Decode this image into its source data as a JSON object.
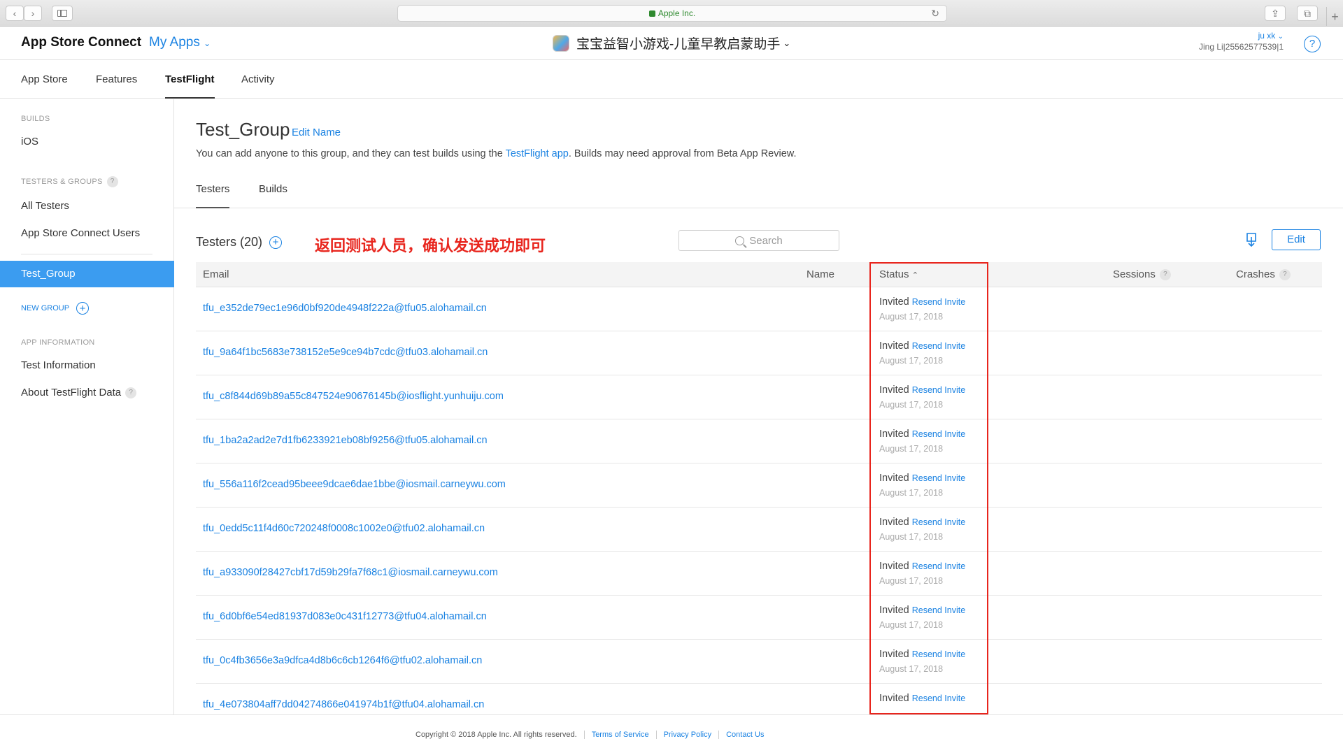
{
  "browser": {
    "url_text": "Apple Inc.",
    "back_glyph": "‹",
    "forward_glyph": "›",
    "reload_glyph": "↻",
    "share_glyph": "⇪",
    "tabs_glyph": "⧉",
    "new_tab_glyph": "+"
  },
  "header": {
    "brand": "App Store Connect",
    "my_apps": "My Apps",
    "app_name": "宝宝益智小游戏-儿童早教启蒙助手",
    "user_name": "ju xk",
    "user_org": "Jing Li|25562577539|1",
    "help_glyph": "?"
  },
  "main_tabs": [
    "App Store",
    "Features",
    "TestFlight",
    "Activity"
  ],
  "sidebar": {
    "builds_heading": "BUILDS",
    "ios": "iOS",
    "testers_heading": "TESTERS & GROUPS",
    "all_testers": "All Testers",
    "asc_users": "App Store Connect Users",
    "active_group": "Test_Group",
    "new_group": "NEW GROUP",
    "app_info_heading": "APP INFORMATION",
    "test_information": "Test Information",
    "about_data": "About TestFlight Data"
  },
  "content": {
    "group_title": "Test_Group",
    "edit_name": "Edit Name",
    "desc_before": "You can add anyone to this group, and they can test builds using the ",
    "desc_link": "TestFlight app",
    "desc_after": ". Builds may need approval from Beta App Review.",
    "subtabs": [
      "Testers",
      "Builds"
    ],
    "testers_title": "Testers (20)",
    "annotation": "返回测试人员，确认发送成功即可",
    "search_placeholder": "Search",
    "edit_button": "Edit"
  },
  "table": {
    "headers": {
      "email": "Email",
      "name": "Name",
      "status": "Status",
      "sessions": "Sessions",
      "crashes": "Crashes"
    },
    "rows": [
      {
        "email": "tfu_e352de79ec1e96d0bf920de4948f222a@tfu05.alohamail.cn",
        "status": "Invited",
        "action": "Resend Invite",
        "date": "August 17, 2018"
      },
      {
        "email": "tfu_9a64f1bc5683e738152e5e9ce94b7cdc@tfu03.alohamail.cn",
        "status": "Invited",
        "action": "Resend Invite",
        "date": "August 17, 2018"
      },
      {
        "email": "tfu_c8f844d69b89a55c847524e90676145b@iosflight.yunhuiju.com",
        "status": "Invited",
        "action": "Resend Invite",
        "date": "August 17, 2018"
      },
      {
        "email": "tfu_1ba2a2ad2e7d1fb6233921eb08bf9256@tfu05.alohamail.cn",
        "status": "Invited",
        "action": "Resend Invite",
        "date": "August 17, 2018"
      },
      {
        "email": "tfu_556a116f2cead95beee9dcae6dae1bbe@iosmail.carneywu.com",
        "status": "Invited",
        "action": "Resend Invite",
        "date": "August 17, 2018"
      },
      {
        "email": "tfu_0edd5c11f4d60c720248f0008c1002e0@tfu02.alohamail.cn",
        "status": "Invited",
        "action": "Resend Invite",
        "date": "August 17, 2018"
      },
      {
        "email": "tfu_a933090f28427cbf17d59b29fa7f68c1@iosmail.carneywu.com",
        "status": "Invited",
        "action": "Resend Invite",
        "date": "August 17, 2018"
      },
      {
        "email": "tfu_6d0bf6e54ed81937d083e0c431f12773@tfu04.alohamail.cn",
        "status": "Invited",
        "action": "Resend Invite",
        "date": "August 17, 2018"
      },
      {
        "email": "tfu_0c4fb3656e3a9dfca4d8b6c6cb1264f6@tfu02.alohamail.cn",
        "status": "Invited",
        "action": "Resend Invite",
        "date": "August 17, 2018"
      },
      {
        "email": "tfu_4e073804aff7dd04274866e041974b1f@tfu04.alohamail.cn",
        "status": "Invited",
        "action": "Resend Invite",
        "date": ""
      }
    ]
  },
  "footer": {
    "copyright": "Copyright © 2018 Apple Inc. All rights reserved.",
    "terms": "Terms of Service",
    "privacy": "Privacy Policy",
    "contact": "Contact Us"
  },
  "colors": {
    "accent": "#1a82e2",
    "sidebar_active": "#3b9cf0",
    "annotation_red": "#e8251d"
  }
}
